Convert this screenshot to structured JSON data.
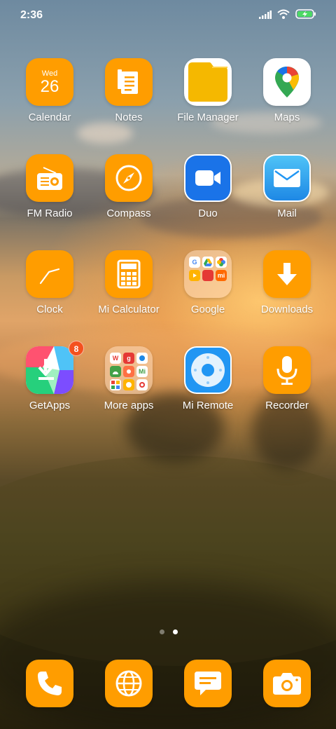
{
  "status_bar": {
    "time": "2:36",
    "icons": [
      "signal-icon",
      "wifi-icon",
      "battery-charging-icon"
    ]
  },
  "apps": [
    {
      "id": "calendar",
      "label": "Calendar",
      "day": "Wed",
      "date": "26"
    },
    {
      "id": "notes",
      "label": "Notes"
    },
    {
      "id": "file-manager",
      "label": "File Manager"
    },
    {
      "id": "maps",
      "label": "Maps"
    },
    {
      "id": "fm-radio",
      "label": "FM Radio"
    },
    {
      "id": "compass",
      "label": "Compass"
    },
    {
      "id": "duo",
      "label": "Duo"
    },
    {
      "id": "mail",
      "label": "Mail"
    },
    {
      "id": "clock",
      "label": "Clock"
    },
    {
      "id": "mi-calculator",
      "label": "Mi Calculator"
    },
    {
      "id": "google",
      "label": "Google"
    },
    {
      "id": "downloads",
      "label": "Downloads"
    },
    {
      "id": "getapps",
      "label": "GetApps",
      "badge": "8"
    },
    {
      "id": "more-apps",
      "label": "More apps"
    },
    {
      "id": "mi-remote",
      "label": "Mi Remote"
    },
    {
      "id": "recorder",
      "label": "Recorder"
    }
  ],
  "google_folder": {
    "mini_icons": [
      "G",
      "",
      "",
      "",
      "",
      "mi"
    ]
  },
  "more_apps_folder": {
    "mini_icons": [
      "W",
      "g",
      "",
      "",
      "",
      "Mi",
      "",
      "",
      ""
    ]
  },
  "page_indicator": {
    "pages": 2,
    "current_page": 2
  },
  "dock": [
    {
      "id": "phone",
      "icon": "phone-icon"
    },
    {
      "id": "browser",
      "icon": "globe-icon"
    },
    {
      "id": "messages",
      "icon": "message-icon"
    },
    {
      "id": "camera",
      "icon": "camera-icon"
    }
  ],
  "colors": {
    "icon_theme": "#ff9d00",
    "label_text": "#ffffff",
    "badge": "#f4511e"
  }
}
